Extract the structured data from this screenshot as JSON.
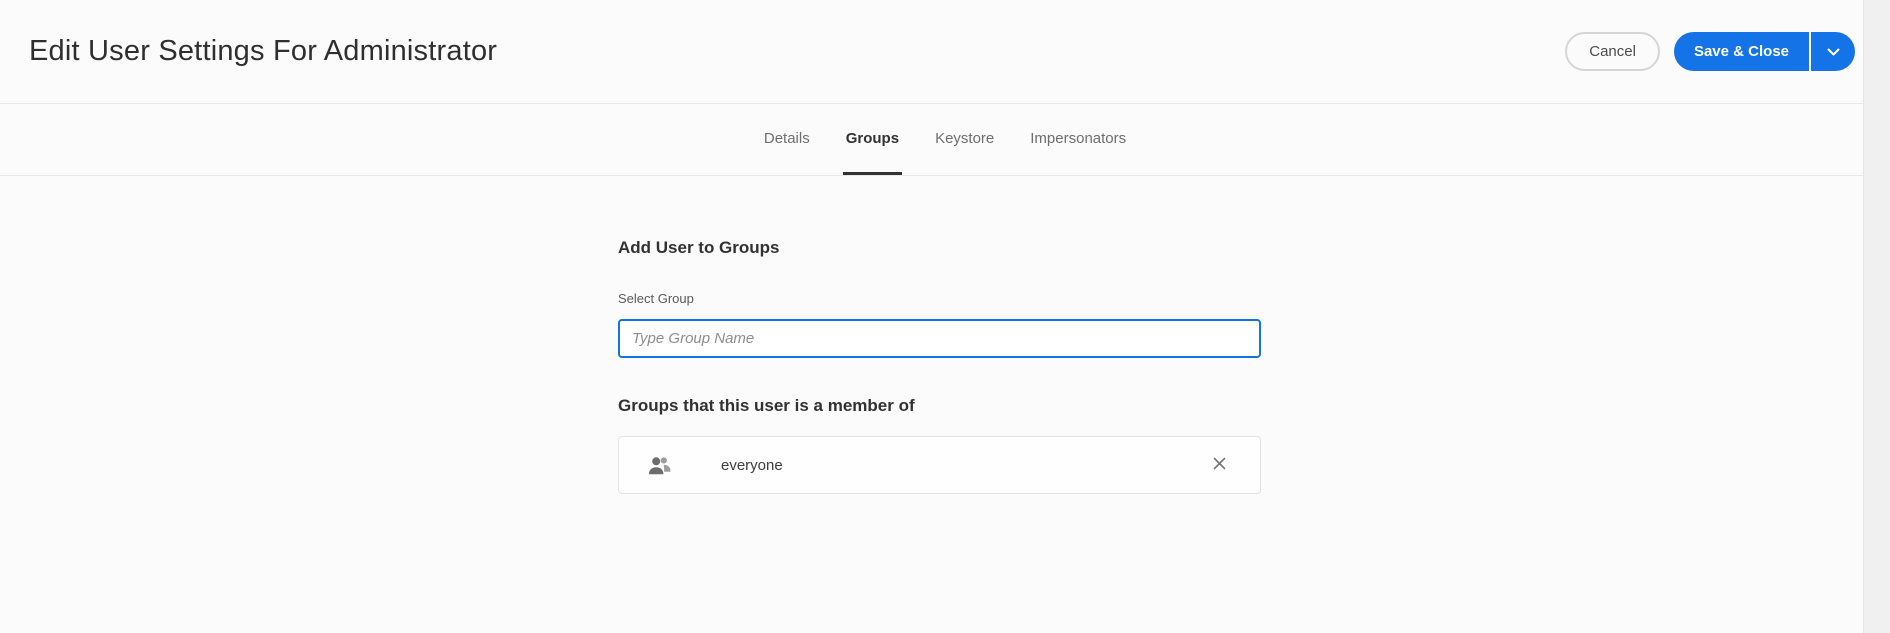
{
  "header": {
    "title": "Edit User Settings For Administrator",
    "actions": {
      "cancel_label": "Cancel",
      "save_label": "Save & Close"
    }
  },
  "tabs": [
    {
      "label": "Details",
      "active": false
    },
    {
      "label": "Groups",
      "active": true
    },
    {
      "label": "Keystore",
      "active": false
    },
    {
      "label": "Impersonators",
      "active": false
    }
  ],
  "content": {
    "add_heading": "Add User to Groups",
    "select_group_label": "Select Group",
    "group_input": {
      "value": "",
      "placeholder": "Type Group Name"
    },
    "member_heading": "Groups that this user is a member of",
    "member_groups": [
      {
        "name": "everyone"
      }
    ]
  },
  "icons": {
    "save_dropdown": "chevron-down-icon",
    "group_avatar": "user-group-icon",
    "remove_group": "close-icon"
  },
  "colors": {
    "accent_blue": "#1473e6",
    "tab_active_underline": "#323232",
    "input_focus_border": "#1473e6",
    "divider": "#e8e8e8"
  }
}
